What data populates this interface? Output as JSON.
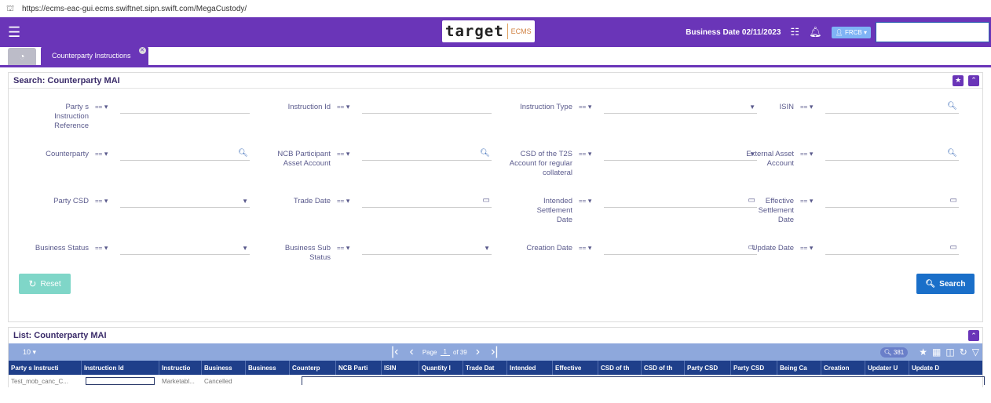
{
  "browser": {
    "url": "https://ecms-eac-gui.ecms.swiftnet.sipn.swift.com/MegaCustody/"
  },
  "header": {
    "logo_text": "target",
    "logo_sub": "ECMS",
    "business_date": "Business Date 02/11/2023",
    "user_label": "FRCB"
  },
  "tabs": {
    "active_label": "Counterparty Instructions"
  },
  "search_panel": {
    "title": "Search: Counterparty MAI",
    "operator": "==",
    "fields": {
      "party_ref": "Party s Instruction Reference",
      "instruction_id": "Instruction Id",
      "instruction_type": "Instruction Type",
      "isin": "ISIN",
      "counterparty": "Counterparty",
      "ncb_participant": "NCB Participant Asset Account",
      "csd_t2s": "CSD of the T2S Account for regular collateral",
      "external_asset": "External Asset Account",
      "party_csd": "Party CSD",
      "trade_date": "Trade Date",
      "intended_settlement": "Intended Settlement Date",
      "effective_settlement": "Effective Settlement Date",
      "business_status": "Business Status",
      "business_sub_status": "Business Sub Status",
      "creation_date": "Creation Date",
      "update_date": "Update Date"
    },
    "reset_label": "Reset",
    "search_label": "Search"
  },
  "list_panel": {
    "title": "List: Counterparty MAI",
    "page_size": "10",
    "page_label": "Page",
    "page_number": "1",
    "page_total": "of 39",
    "result_count": "381",
    "columns": [
      "Party s Instructi",
      "Instruction Id",
      "Instructio",
      "Business",
      "Business",
      "Counterp",
      "NCB Parti",
      "ISIN",
      "Quantity I",
      "Trade Dat",
      "Intended",
      "Effective",
      "CSD of th",
      "CSD of th",
      "Party CSD",
      "Party CSD",
      "Being Ca",
      "Creation",
      "Updater U",
      "Update D"
    ],
    "rows": [
      {
        "party_ref": "Test_mob_canc_C...",
        "instruction_type": "Marketabl...",
        "business_status": "Cancelled"
      }
    ]
  }
}
